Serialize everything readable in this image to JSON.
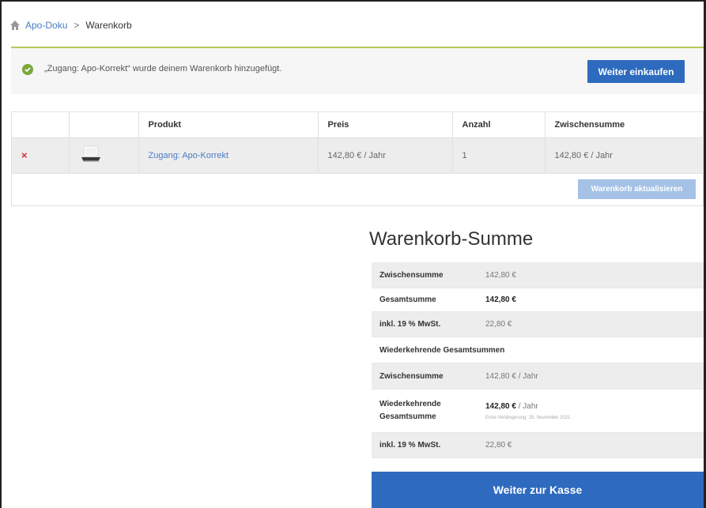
{
  "breadcrumb": {
    "home_icon": "home-icon",
    "link": "Apo-Doku",
    "separator": ">",
    "current": "Warenkorb"
  },
  "notice": {
    "icon": "check-circle-icon",
    "text": "„Zugang: Apo-Korrekt“ wurde deinem Warenkorb hinzugefügt.",
    "button": "Weiter einkaufen"
  },
  "cart": {
    "headers": [
      "",
      "",
      "Produkt",
      "Preis",
      "Anzahl",
      "Zwischensumme"
    ],
    "items": [
      {
        "remove": "×",
        "product": "Zugang: Apo-Korrekt",
        "price": "142,80 € / Jahr",
        "quantity": "1",
        "subtotal": "142,80 € / Jahr"
      }
    ],
    "update_button": "Warenkorb aktualisieren"
  },
  "totals": {
    "title": "Warenkorb-Summe",
    "subtotal_label": "Zwischensumme",
    "subtotal_value": "142,80 €",
    "total_label": "Gesamtsumme",
    "total_value": "142,80 €",
    "tax_label": "inkl. 19 % MwSt.",
    "tax_value": "22,80 €",
    "recurring_heading": "Wiederkehrende Gesamtsummen",
    "rec_subtotal_label": "Zwischensumme",
    "rec_subtotal_value": "142,80 € / Jahr",
    "rec_total_label_1": "Wiederkehrende",
    "rec_total_label_2": "Gesamtsumme",
    "rec_total_amount": "142,80 €",
    "rec_total_period": " / Jahr",
    "rec_total_note": "Erste Verlängerung: 25. November 2021",
    "rec_tax_label": "inkl. 19 % MwSt.",
    "rec_tax_value": "22,80 €"
  },
  "checkout_button": "Weiter zur Kasse",
  "colors": {
    "primary": "#2e6bbf",
    "primary_disabled": "#a5c2e6",
    "link": "#4b7cc1",
    "success": "#7aa83a",
    "notice_border": "#b5c95d",
    "remove": "#d9282f"
  }
}
